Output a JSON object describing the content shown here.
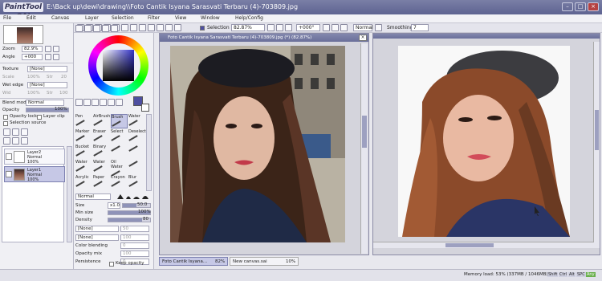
{
  "app": {
    "logo_text": "PaintTool SAI",
    "title": "E:\\Back up\\dewi\\drawing\\\\Foto Cantik Isyana Sarasvati Terbaru (4)-703809.jpg"
  },
  "menu": [
    "File",
    "Edit",
    "Canvas",
    "Layer",
    "Selection",
    "Filter",
    "View",
    "Window",
    "Help/Config"
  ],
  "toolbar": {
    "selection_label": "Selection",
    "zoom_value": "82.87%",
    "angle_value": "+000°",
    "blend_value": "Normal",
    "smoothing_label": "Smoothing",
    "smoothing_value": "7"
  },
  "navigator": {
    "zoom_label": "Zoom",
    "zoom_value": "82.9%",
    "angle_label": "Angle",
    "angle_value": "+000"
  },
  "texture": {
    "label": "Texture",
    "value": "[None]",
    "scale_label": "Scale",
    "scale_value": "100%",
    "strength_label": "Str",
    "strength_value": "20"
  },
  "wet_edge": {
    "label": "Wet edge",
    "value": "[None]",
    "width_label": "Wid",
    "width_value": "100%",
    "strength_label": "Str",
    "strength_value": "100"
  },
  "layer_props": {
    "blend_label": "Blend mode",
    "blend_value": "Normal",
    "opacity_label": "Opacity",
    "opacity_value": "100%",
    "opacity_fraction": 1.0,
    "opacity_lock": "Opacity lock",
    "layer_clip": "Layer clip",
    "selection_source": "Selection source"
  },
  "layers": [
    {
      "name": "Layer2",
      "mode": "Normal",
      "opacity": "100%",
      "selected": false
    },
    {
      "name": "Layer1",
      "mode": "Normal",
      "opacity": "100%",
      "selected": true
    }
  ],
  "brushes": [
    {
      "name": "Pen",
      "selected": false
    },
    {
      "name": "AirBrush",
      "selected": false
    },
    {
      "name": "Brush",
      "selected": true
    },
    {
      "name": "Water",
      "selected": false
    },
    {
      "name": "Marker",
      "selected": false
    },
    {
      "name": "Eraser",
      "selected": false
    },
    {
      "name": "Select",
      "selected": false
    },
    {
      "name": "Deselect",
      "selected": false
    },
    {
      "name": "Bucket",
      "selected": false
    },
    {
      "name": "Binary",
      "selected": false
    },
    {
      "name": "",
      "selected": false
    },
    {
      "name": "",
      "selected": false
    },
    {
      "name": "Water",
      "selected": false
    },
    {
      "name": "Water",
      "selected": false
    },
    {
      "name": "Oil Water",
      "selected": false
    },
    {
      "name": "",
      "selected": false
    },
    {
      "name": "Acrylic",
      "selected": false
    },
    {
      "name": "Paper",
      "selected": false
    },
    {
      "name": "Crayon",
      "selected": false
    },
    {
      "name": "Blur",
      "selected": false
    }
  ],
  "brush_settings": {
    "mode_value": "Normal",
    "size_label": "Size",
    "size_mult": "x1.0",
    "size_value": "50.0",
    "minsize_label": "Min size",
    "minsize_value": "100%",
    "minsize_fraction": 1.0,
    "density_label": "Density",
    "density_value": "80",
    "density_fraction": 0.8,
    "shape1_value": "[None]",
    "shape1_num": "50",
    "shape2_value": "[None]",
    "shape2_num": "100",
    "color_blending_label": "Color blending",
    "color_blending_value": "0",
    "opacity_mix_label": "Opacity mix",
    "opacity_mix_value": "100",
    "persistence_label": "Persistence",
    "persistence_value": "0",
    "keep_opacity_label": "Keep opacity"
  },
  "canvases": {
    "left_title": "Foto Cantik Isyana Sarasvati Terbaru (4)-703809.jpg (*) (82.87%)",
    "right_title": "New canvas.sai"
  },
  "tabs": [
    {
      "name": "Foto Cantik Isyana...",
      "zoom": "82%"
    },
    {
      "name": "New canvas.sai",
      "zoom": "10%"
    }
  ],
  "status": {
    "memory": "Memory load: 53% (337MB / 1046MB)",
    "indicators": [
      "Shift",
      "Ctrl",
      "Alt",
      "SPC",
      "Any"
    ]
  },
  "colors": {
    "primary": "#4e4fa0",
    "secondary": "#ffffff",
    "accent": "#6a6f9a"
  }
}
